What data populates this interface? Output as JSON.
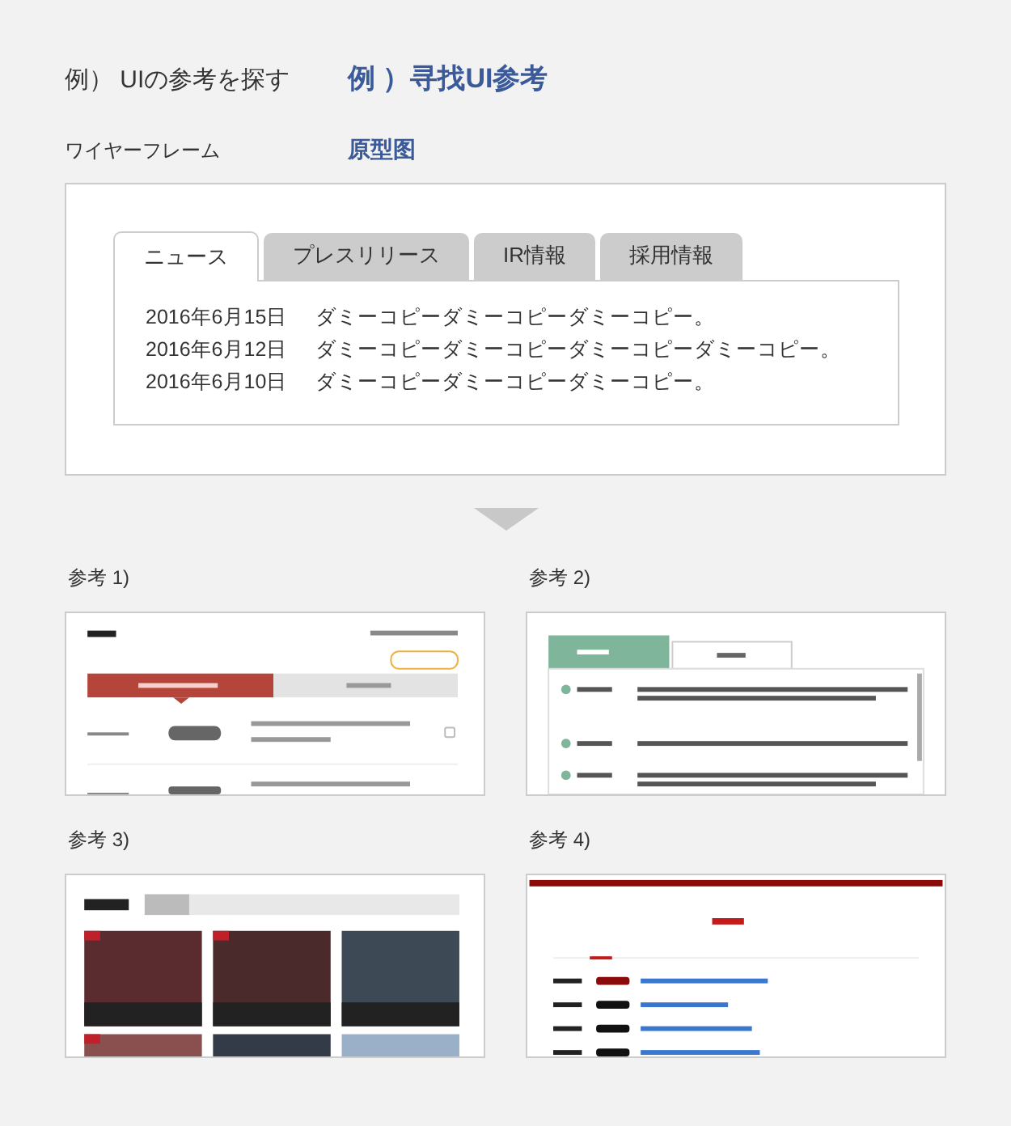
{
  "heading": {
    "label": "例） UIの参考を探す",
    "translation": "例 ）寻找UI参考"
  },
  "subheading": {
    "label": "ワイヤーフレーム",
    "translation": "原型图"
  },
  "wireframe": {
    "tabs": [
      {
        "label": "ニュース",
        "selected": true
      },
      {
        "label": "プレスリリース",
        "selected": false
      },
      {
        "label": "IR情報",
        "selected": false
      },
      {
        "label": "採用情報",
        "selected": false
      }
    ],
    "news": [
      {
        "date": "2016年6月15日",
        "text": "ダミーコピーダミーコピーダミーコピー。"
      },
      {
        "date": "2016年6月12日",
        "text": "ダミーコピーダミーコピーダミーコピーダミーコピー。"
      },
      {
        "date": "2016年6月10日",
        "text": "ダミーコピーダミーコピーダミーコピー。"
      }
    ]
  },
  "references": [
    {
      "label": "参考 1)",
      "kind": "red-tabs"
    },
    {
      "label": "参考 2)",
      "kind": "green-tabs"
    },
    {
      "label": "参考 3)",
      "kind": "models"
    },
    {
      "label": "参考 4)",
      "kind": "news-list"
    }
  ]
}
